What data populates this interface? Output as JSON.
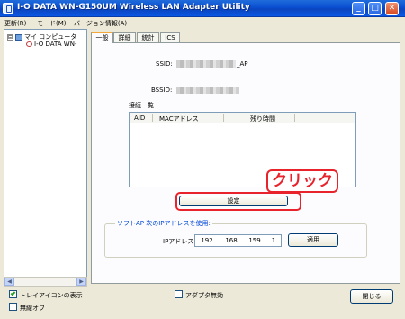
{
  "window": {
    "title": "I-O DATA WN-G150UM Wireless LAN Adapter Utility"
  },
  "title_buttons": {
    "minimize": "_",
    "maximize": "□",
    "close": "✕"
  },
  "menu": [
    {
      "label": "更新(R)"
    },
    {
      "label": "モード(M)"
    },
    {
      "label": "バージョン情報(A)"
    }
  ],
  "tree": {
    "root_toggle": "⊟",
    "root_label": "マイ コンピュータ",
    "child_label": "I-O DATA WN-"
  },
  "tabs": [
    {
      "label": "一般",
      "active": true
    },
    {
      "label": "詳細",
      "active": false
    },
    {
      "label": "統計",
      "active": false
    },
    {
      "label": "ICS",
      "active": false
    }
  ],
  "general": {
    "ssid_label": "SSID:",
    "ssid_visible_suffix": "_AP",
    "bssid_label": "BSSID:",
    "connection_list_title": "接続一覧",
    "columns": [
      "AID",
      "MACアドレス",
      "残り時間"
    ],
    "settings_button": "設定",
    "callout_text": "クリック",
    "softap_group_title": "ソフトAP 次のIPアドレスを使用:",
    "ip_label": "IPアドレス:",
    "ip_octets": [
      "192",
      "168",
      "159",
      "1"
    ],
    "apply_button": "適用"
  },
  "footer": {
    "tray_icon_label": "トレイアイコンの表示",
    "tray_icon_checked": true,
    "radio_off_label": "無線オフ",
    "radio_off_checked": false,
    "adapter_disable_label": "アダプタ無効",
    "adapter_disable_checked": false,
    "close_button": "閉じる"
  },
  "scroll_arrows": {
    "left": "◀",
    "right": "▶"
  },
  "colors": {
    "titlebar": "#0a4fd1",
    "highlight": "#e8232b",
    "group_title": "#0046d5",
    "window_bg": "#ece9d8"
  }
}
